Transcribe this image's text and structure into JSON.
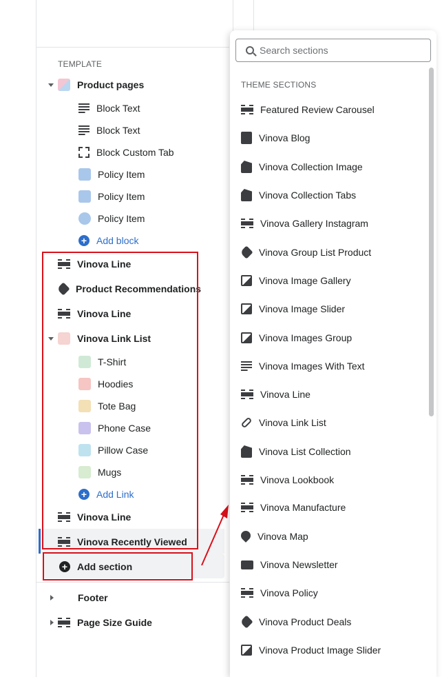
{
  "template": {
    "heading": "TEMPLATE",
    "product_pages": "Product pages",
    "blocks": [
      {
        "label": "Block Text",
        "icon": "text-lines-icon"
      },
      {
        "label": "Block Text",
        "icon": "text-lines-icon"
      },
      {
        "label": "Block Custom Tab",
        "icon": "dashed-box-icon"
      },
      {
        "label": "Policy Item",
        "icon": "truck-icon"
      },
      {
        "label": "Policy Item",
        "icon": "calendar-icon"
      },
      {
        "label": "Policy Item",
        "icon": "return-icon"
      }
    ],
    "add_block": "Add block",
    "sections": [
      {
        "label": "Vinova Line"
      },
      {
        "label": "Product Recommendations"
      },
      {
        "label": "Vinova Line"
      },
      {
        "label": "Vinova Link List"
      }
    ],
    "links": [
      {
        "label": "T-Shirt",
        "color": "#cfe9d6"
      },
      {
        "label": "Hoodies",
        "color": "#f5c6c3"
      },
      {
        "label": "Tote Bag",
        "color": "#f3e0b5"
      },
      {
        "label": "Phone Case",
        "color": "#c9c2ee"
      },
      {
        "label": "Pillow Case",
        "color": "#bfe2ef"
      },
      {
        "label": "Mugs",
        "color": "#d7ecd0"
      }
    ],
    "add_link": "Add Link",
    "vinova_line_2": "Vinova Line",
    "recently_viewed": "Vinova Recently Viewed",
    "add_section": "Add section",
    "footer": "Footer",
    "page_size_guide": "Page Size Guide"
  },
  "dropdown": {
    "search_placeholder": "Search sections",
    "heading": "THEME SECTIONS",
    "items": [
      {
        "label": "Featured Review Carousel",
        "icon": "section-icon"
      },
      {
        "label": "Vinova Blog",
        "icon": "blog-icon"
      },
      {
        "label": "Vinova Collection Image",
        "icon": "collection-icon"
      },
      {
        "label": "Vinova Collection Tabs",
        "icon": "collection-icon"
      },
      {
        "label": "Vinova Gallery Instagram",
        "icon": "section-icon"
      },
      {
        "label": "Vinova Group List Product",
        "icon": "tag-icon"
      },
      {
        "label": "Vinova Image Gallery",
        "icon": "image-icon"
      },
      {
        "label": "Vinova Image Slider",
        "icon": "image-icon"
      },
      {
        "label": "Vinova Images Group",
        "icon": "image-icon"
      },
      {
        "label": "Vinova Images With Text",
        "icon": "text-block-icon"
      },
      {
        "label": "Vinova Line",
        "icon": "section-icon"
      },
      {
        "label": "Vinova Link List",
        "icon": "link-icon"
      },
      {
        "label": "Vinova List Collection",
        "icon": "collection-icon"
      },
      {
        "label": "Vinova Lookbook",
        "icon": "section-icon"
      },
      {
        "label": "Vinova Manufacture",
        "icon": "section-icon"
      },
      {
        "label": "Vinova Map",
        "icon": "map-pin-icon"
      },
      {
        "label": "Vinova Newsletter",
        "icon": "mail-icon"
      },
      {
        "label": "Vinova Policy",
        "icon": "section-icon"
      },
      {
        "label": "Vinova Product Deals",
        "icon": "tag-icon"
      },
      {
        "label": "Vinova Product Image Slider",
        "icon": "image-icon"
      }
    ]
  },
  "colors": {
    "accent": "#2c6ecb",
    "highlight": "#d8101a"
  }
}
